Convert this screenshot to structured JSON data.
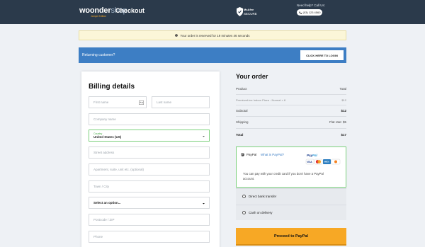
{
  "header": {
    "logo_main": "woonder",
    "logo_accent": "shop",
    "logo_sub": "Jampe Edition",
    "title": "Checkout",
    "secure_brand": "McAfee",
    "secure_word": "SECURE",
    "help_text": "Need help? Call Us:",
    "phone": "(03) 123 4560"
  },
  "reserve_notice": "Your order is reserved for 19 minutes 46 seconds",
  "returning": {
    "text": "Returning customer?",
    "button": "CLICK HERE TO LOGIN"
  },
  "billing": {
    "title": "Billing details",
    "first_name": "First name",
    "last_name": "Last name",
    "company": "Company name",
    "country_label": "Country",
    "country_value": "United States (US)",
    "street": "Street address",
    "apartment": "Apartment, suite, unit etc. (optional)",
    "city": "Town / City",
    "state_select": "Select an option...",
    "postcode": "Postcode / ZIP",
    "phone": "Phone"
  },
  "order": {
    "title": "Your order",
    "col_product": "Product",
    "col_total": "Total",
    "item_name": "PremiumLine Indoor Pizza - Normal × 8",
    "item_total": "$12",
    "subtotal_label": "Subtotal",
    "subtotal_value": "$12",
    "shipping_label": "Shipping",
    "shipping_value": "Flat rate: $5",
    "total_label": "Total",
    "total_value": "$17"
  },
  "payment": {
    "paypal_label": "PayPal",
    "paypal_link": "What is PayPal?",
    "paypal_desc": "You can pay with your credit card if you don't have a PayPal account.",
    "bank_transfer": "Direct bank transfer",
    "cod": "Cash on delivery",
    "proceed_button": "Proceed to PayPal"
  },
  "colors": {
    "header_bg": "#2b3a4b",
    "accent_blue": "#3d7ec4",
    "accent_orange": "#f7a825",
    "focus_green": "#7bd07b"
  }
}
